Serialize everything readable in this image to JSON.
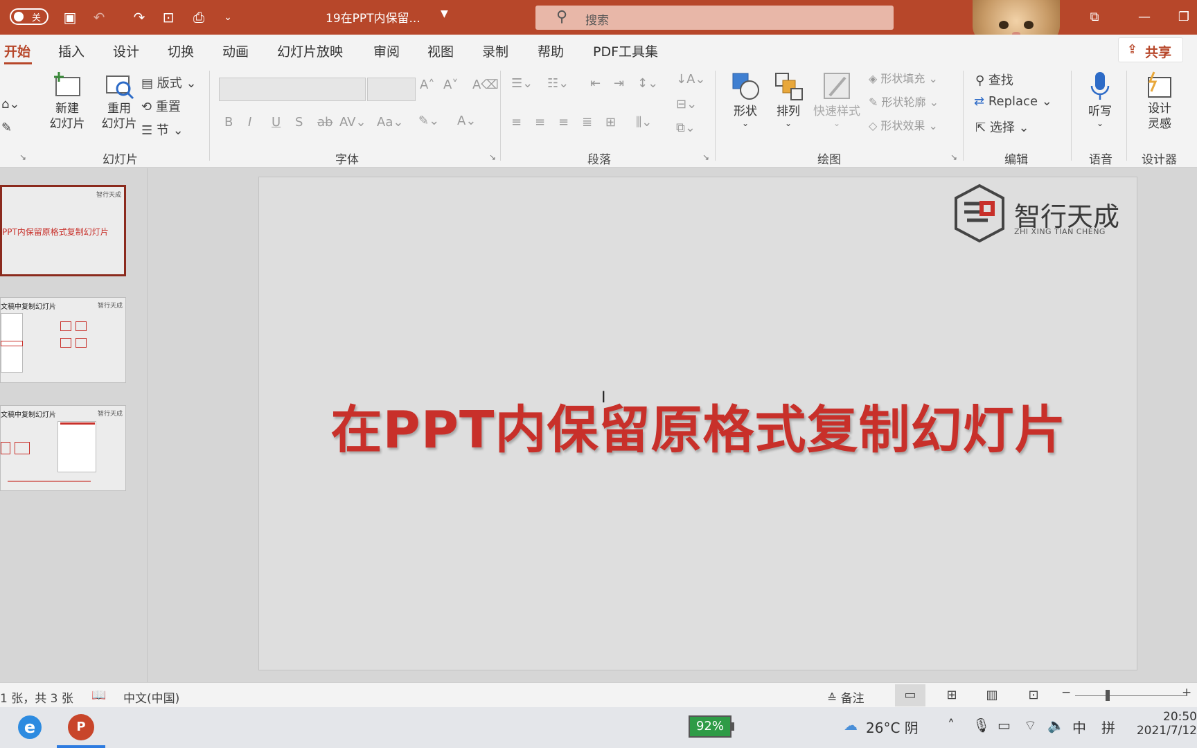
{
  "titlebar": {
    "autosave_state": "关",
    "doc_title": "19在PPT内保留...",
    "search_placeholder": "搜索"
  },
  "tabs": [
    "开始",
    "插入",
    "设计",
    "切换",
    "动画",
    "幻灯片放映",
    "审阅",
    "视图",
    "录制",
    "帮助",
    "PDF工具集"
  ],
  "share_label": "共享",
  "ribbon": {
    "slides": {
      "label": "幻灯片",
      "new_slide": "新建\n幻灯片",
      "reuse_slides": "重用\n幻灯片",
      "layout": "版式",
      "reset": "重置",
      "section": "节"
    },
    "font": {
      "label": "字体",
      "bold": "B",
      "italic": "I",
      "underline": "U",
      "shadow": "S",
      "strike": "ab",
      "spacing": "AV",
      "case": "Aa"
    },
    "paragraph": {
      "label": "段落"
    },
    "drawing": {
      "label": "绘图",
      "shapes": "形状",
      "arrange": "排列",
      "quick_styles": "快速样式",
      "fill": "形状填充",
      "outline": "形状轮廓",
      "effects": "形状效果"
    },
    "editing": {
      "label": "编辑",
      "find": "查找",
      "replace": "Replace",
      "select": "选择"
    },
    "voice": {
      "label": "语音",
      "dictate": "听写"
    },
    "designer": {
      "label": "设计器",
      "design_ideas": "设计\n灵感"
    }
  },
  "thumbnails": [
    {
      "title": "PPT内保留原格式复制幻灯片",
      "selected": true
    },
    {
      "title": "文稿中复制幻灯片",
      "selected": false
    },
    {
      "title": "文稿中复制幻灯片",
      "selected": false
    }
  ],
  "slide": {
    "title": "在PPT内保留原格式复制幻灯片",
    "logo_cn": "智行天成",
    "logo_en": "ZHI XING TIAN CHENG"
  },
  "statusbar": {
    "slide_count": "1 张，共 3 张",
    "language": "中文(中国)",
    "notes": "备注"
  },
  "taskbar": {
    "battery": "92%",
    "weather": "26°C 阴",
    "ime_lang": "中",
    "ime_mode": "拼",
    "time": "20:50",
    "date": "2021/7/12"
  }
}
